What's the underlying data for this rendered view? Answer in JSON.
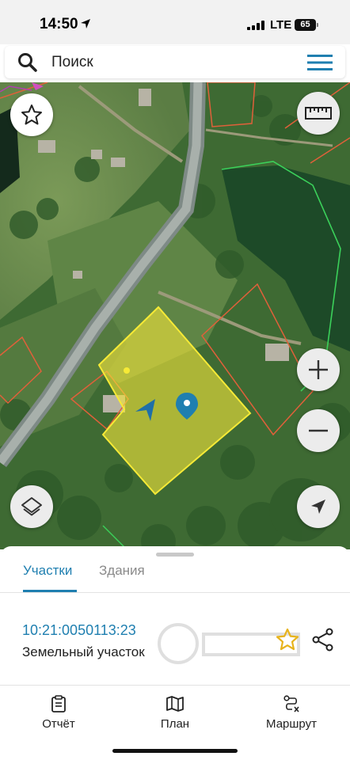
{
  "status_bar": {
    "time": "14:50",
    "network": "LTE",
    "battery": "65"
  },
  "search": {
    "placeholder": "Поиск"
  },
  "map": {
    "selected_parcel_color": "#f1e43a",
    "boundary_color": "#e0603a",
    "accent_color": "#1f7fb0"
  },
  "tabs": [
    {
      "label": "Участки",
      "active": true
    },
    {
      "label": "Здания",
      "active": false
    }
  ],
  "parcel": {
    "number": "10:21:0050113:23",
    "type": "Земельный участок"
  },
  "bottom_nav": [
    {
      "label": "Отчёт",
      "icon": "report-icon"
    },
    {
      "label": "План",
      "icon": "map-plan-icon"
    },
    {
      "label": "Маршрут",
      "icon": "route-icon"
    }
  ]
}
